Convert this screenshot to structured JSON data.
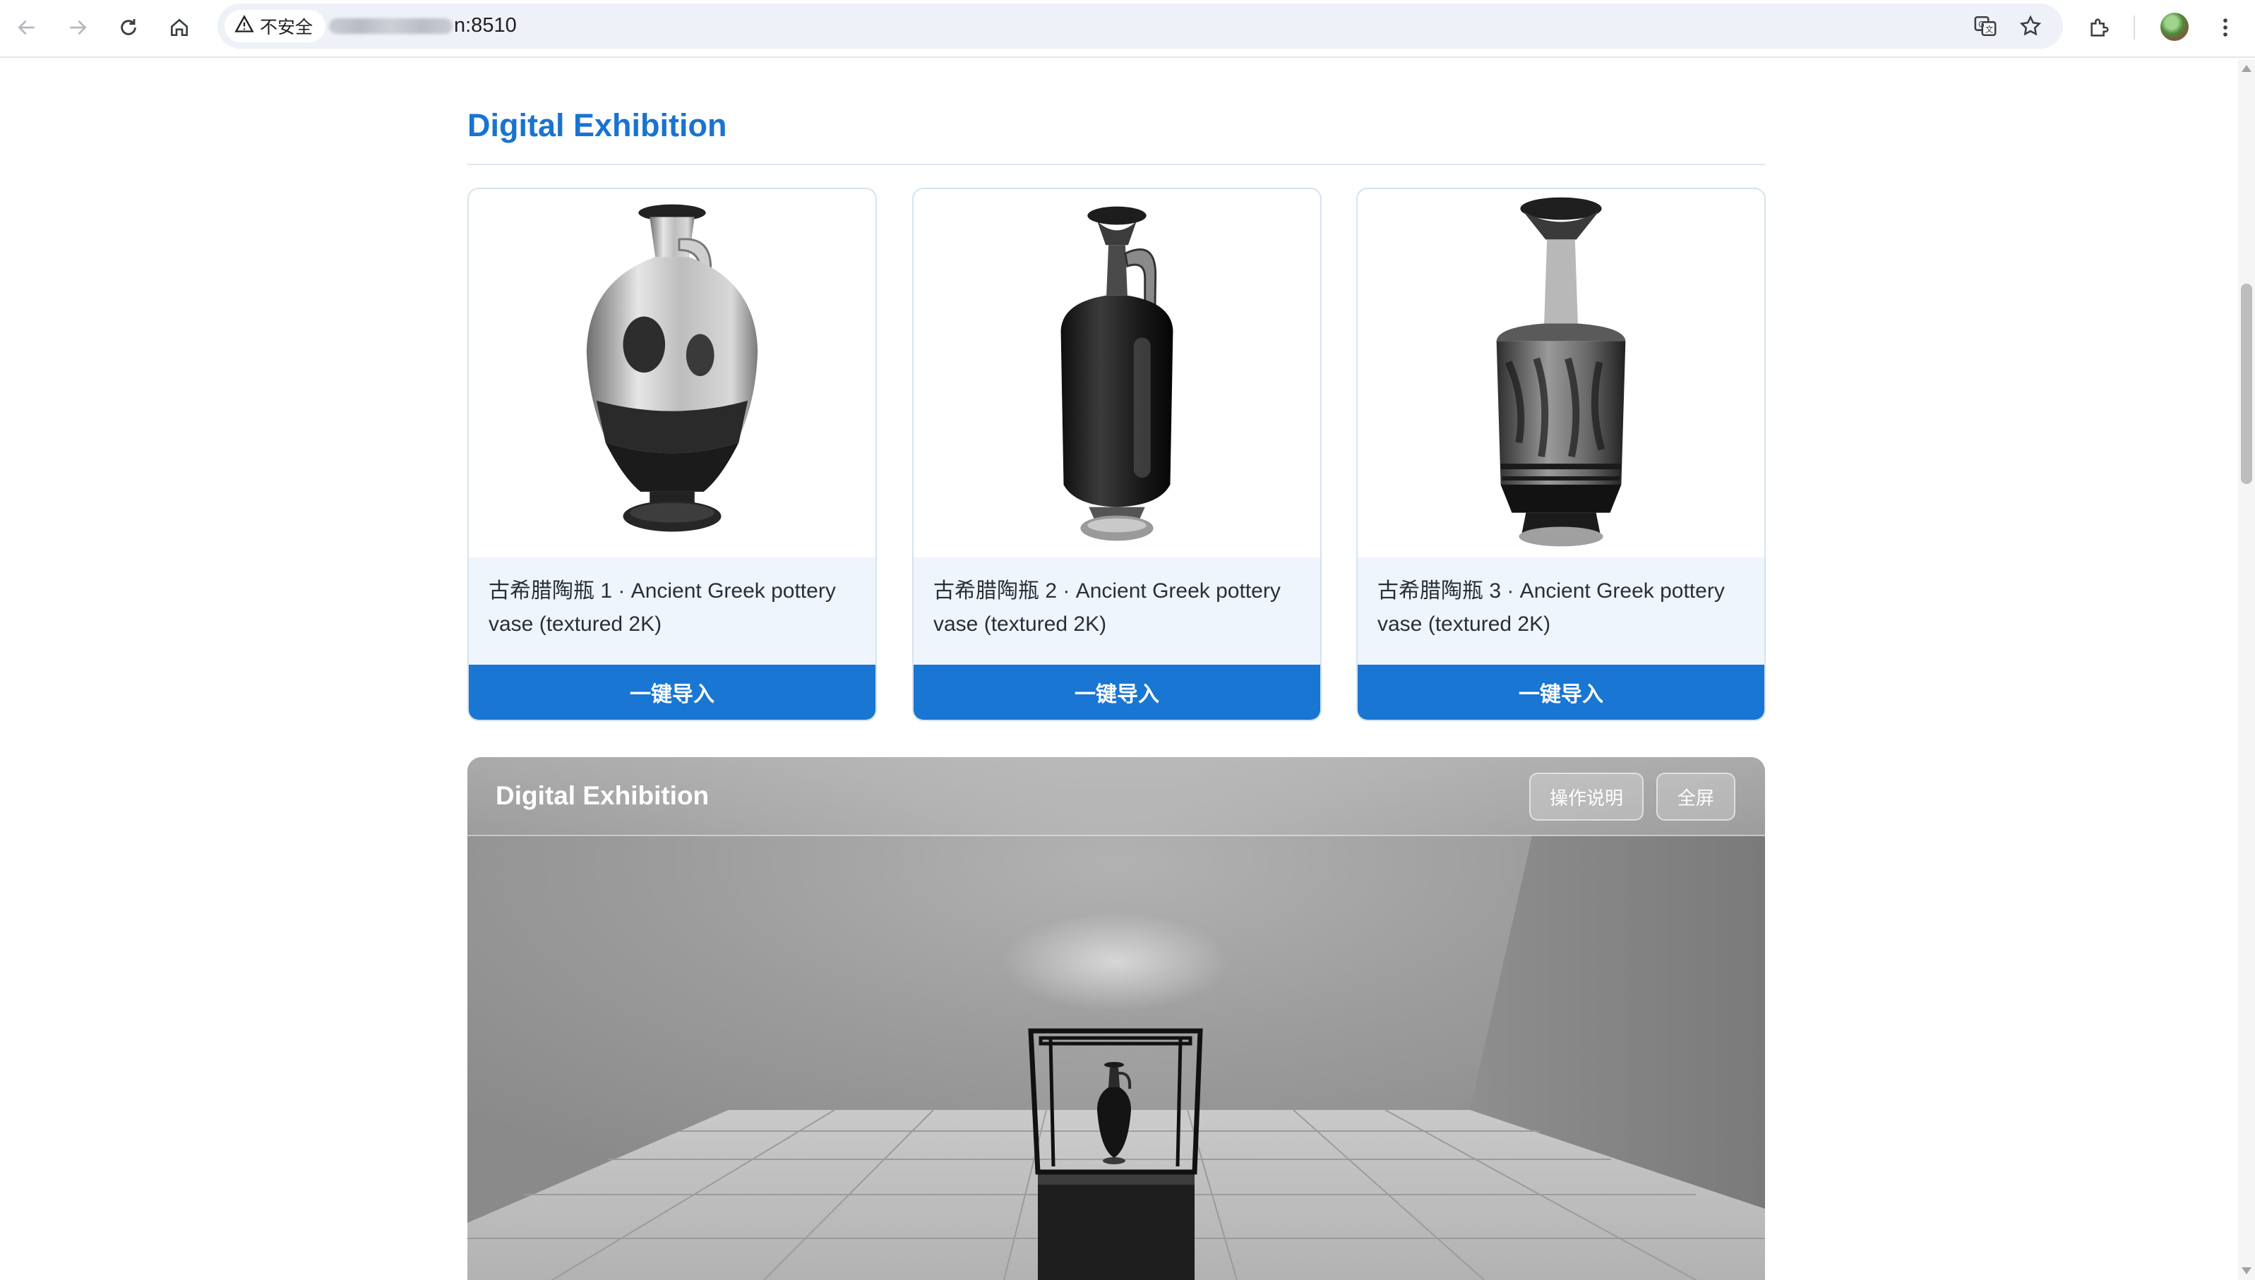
{
  "browser": {
    "security_label": "不安全",
    "url_suffix": "n:8510"
  },
  "page": {
    "section_title": "Digital Exhibition"
  },
  "cards": [
    {
      "caption": "古希腊陶瓶 1 · Ancient Greek pottery vase (textured 2K)",
      "button_label": "一键导入"
    },
    {
      "caption": "古希腊陶瓶 2 · Ancient Greek pottery vase (textured 2K)",
      "button_label": "一键导入"
    },
    {
      "caption": "古希腊陶瓶 3 · Ancient Greek pottery vase (textured 2K)",
      "button_label": "一键导入"
    }
  ],
  "viewer": {
    "title": "Digital Exhibition",
    "help_button": "操作说明",
    "fullscreen_button": "全屏"
  },
  "icons": [
    "back-icon",
    "forward-icon",
    "reload-icon",
    "home-icon",
    "warning-icon",
    "translate-icon",
    "star-icon",
    "extensions-icon",
    "avatar",
    "menu-icon"
  ],
  "colors": {
    "accent": "#1976d2",
    "title": "#1a73d1",
    "caption_bg": "#eef5fd"
  }
}
